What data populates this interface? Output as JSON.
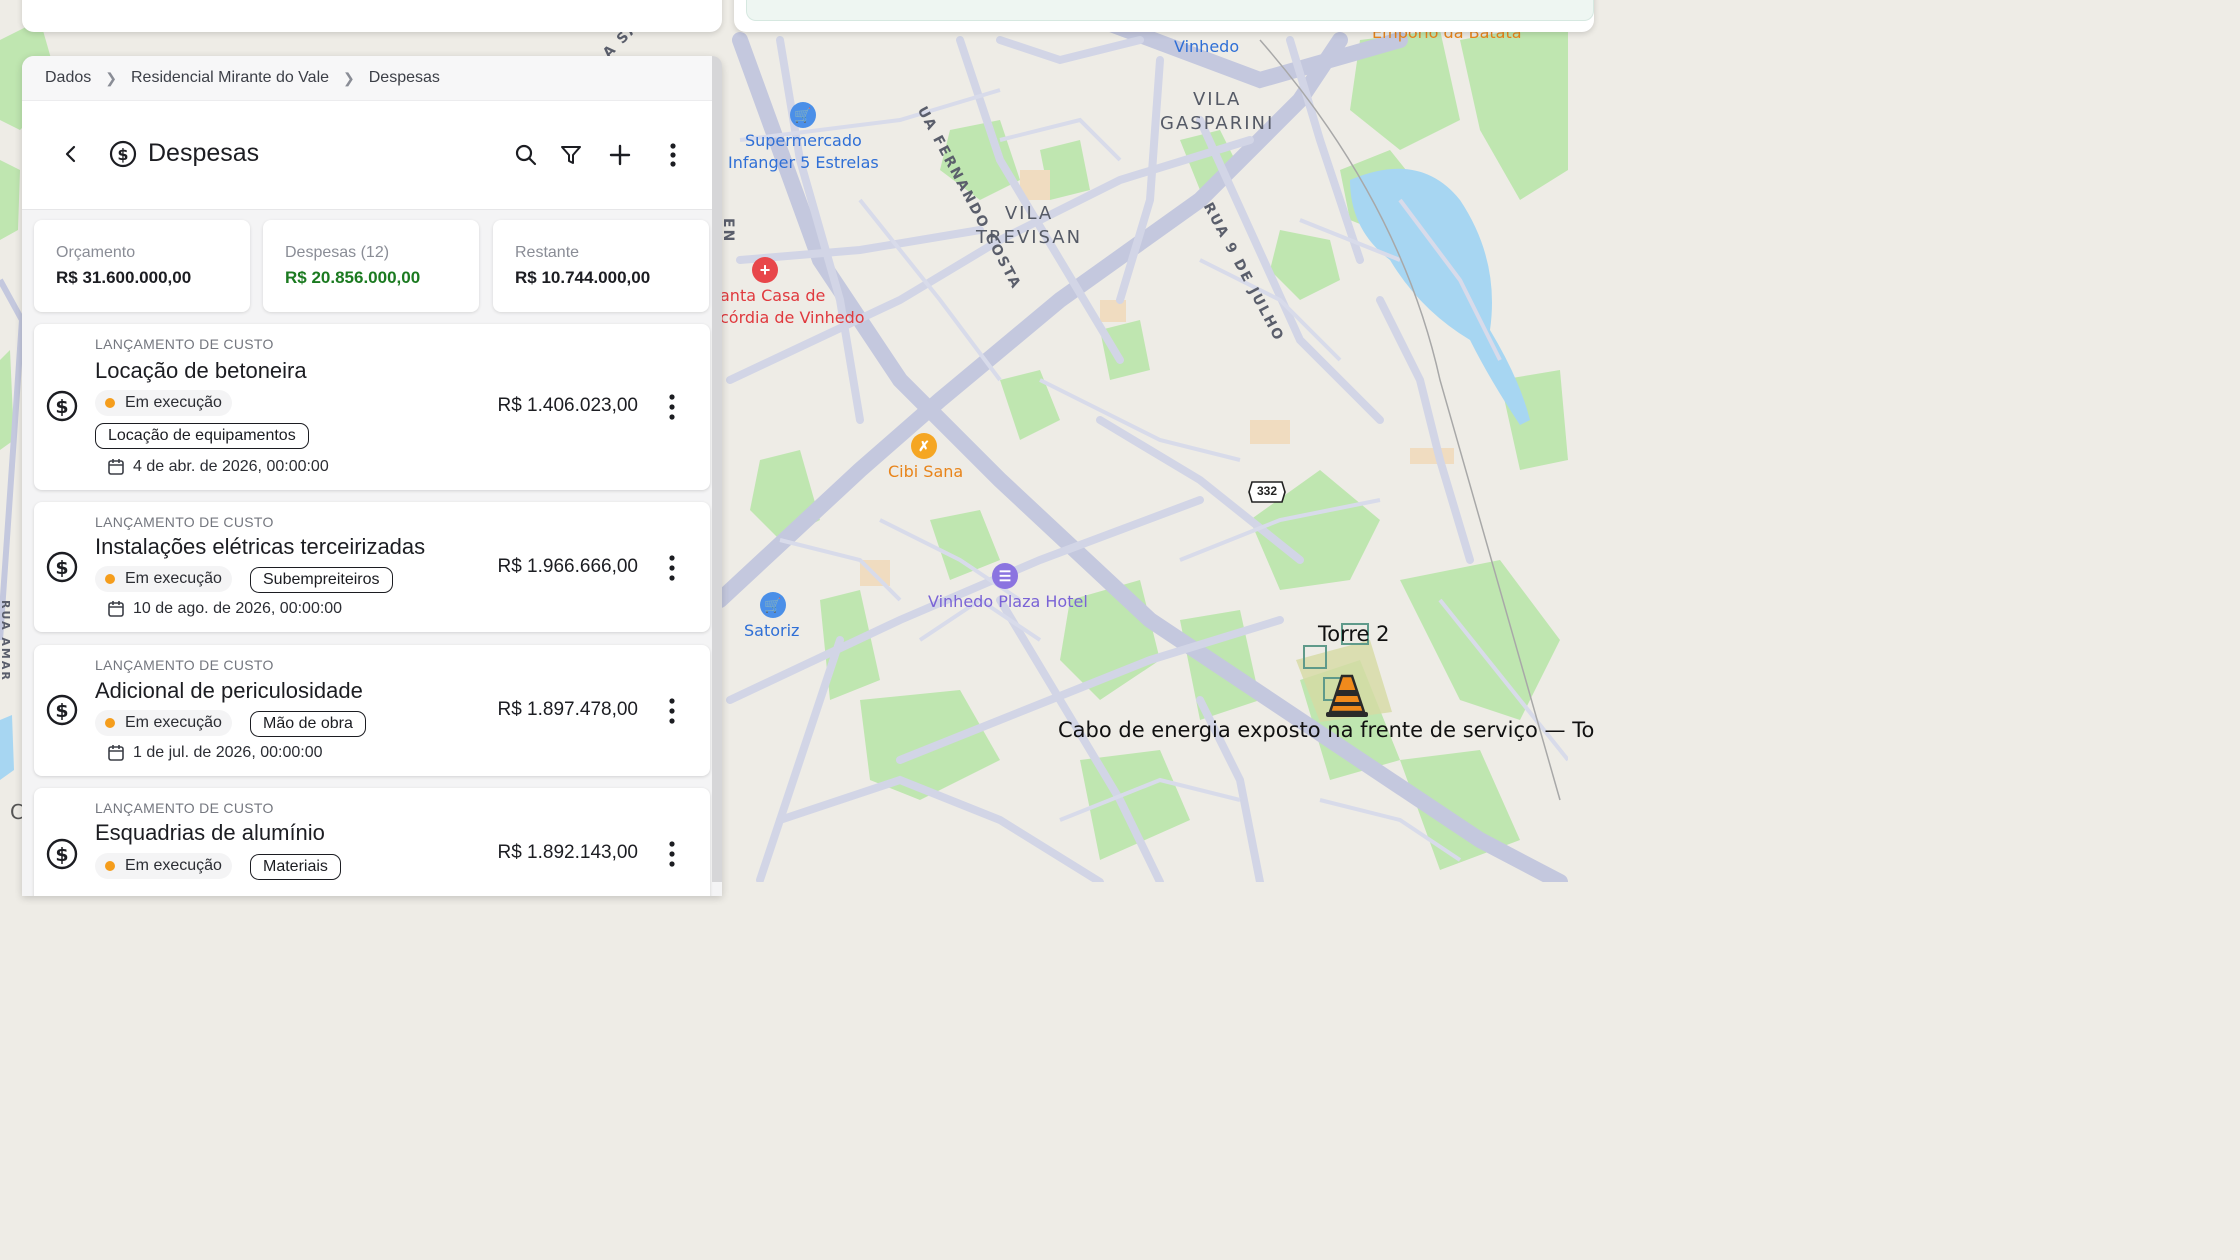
{
  "breadcrumb": [
    "Dados",
    "Residencial Mirante do Vale",
    "Despesas"
  ],
  "header": {
    "title": "Despesas",
    "icons": [
      "back-arrow-icon",
      "dollar-circle-icon",
      "search-icon",
      "filter-icon",
      "plus-icon",
      "more-vert-icon"
    ]
  },
  "summary": {
    "budget": {
      "label": "Orçamento",
      "value": "R$ 31.600.000,00"
    },
    "expenses": {
      "label": "Despesas (12)",
      "value": "R$ 20.856.000,00",
      "color": "#1b7a20"
    },
    "remaining": {
      "label": "Restante",
      "value": "R$ 10.744.000,00"
    }
  },
  "expenses": [
    {
      "type": "LANÇAMENTO DE CUSTO",
      "title": "Locação de betoneira",
      "status": "Em execução",
      "category": "Locação de equipamentos",
      "date": "4 de abr. de 2026, 00:00:00",
      "amount": "R$ 1.406.023,00"
    },
    {
      "type": "LANÇAMENTO DE CUSTO",
      "title": "Instalações elétricas terceirizadas",
      "status": "Em execução",
      "category": "Subempreiteiros",
      "date": "10 de ago. de 2026, 00:00:00",
      "amount": "R$ 1.966.666,00"
    },
    {
      "type": "LANÇAMENTO DE CUSTO",
      "title": "Adicional de periculosidade",
      "status": "Em execução",
      "category": "Mão de obra",
      "date": "1 de jul. de 2026, 00:00:00",
      "amount": "R$ 1.897.478,00"
    },
    {
      "type": "LANÇAMENTO DE CUSTO",
      "title": "Esquadrias de alumínio",
      "status": "Em execução",
      "category": "Materiais",
      "date": "",
      "amount": "R$ 1.892.143,00"
    }
  ],
  "status_color": "#f59d1c",
  "map": {
    "streets": [
      "UA FERNANDO COSTA",
      "RUA 9 DE JULHO",
      "A SA",
      "EN",
      "RUA AMAR"
    ],
    "districts": [
      "VILA\nGASPARINI",
      "VILA\nTREVISAN"
    ],
    "places": [
      {
        "name": "Vinhedo",
        "color": "#2f6fd6"
      },
      {
        "name": "Emporio da Batata",
        "color": "#e8841a"
      },
      {
        "name": "Supermercado\nInfanger 5 Estrelas",
        "color": "#2f6fd6",
        "icon": "cart-icon"
      },
      {
        "name": "anta Casa de\ncórdia de Vinhedo",
        "color": "#e0393e",
        "icon": "hospital-icon"
      },
      {
        "name": "Cibi Sana",
        "color": "#e8841a",
        "icon": "restaurant-icon"
      },
      {
        "name": "Vinhedo Plaza Hotel",
        "color": "#7a63d6",
        "icon": "hotel-icon"
      },
      {
        "name": "Satoriz",
        "color": "#2f6fd6",
        "icon": "cart-icon"
      }
    ],
    "road_shield": "332",
    "site_label": "Torre 2",
    "alert_text": "Cabo de energia exposto na frente de serviço — To",
    "edge_letter": "C",
    "colors": {
      "land": "#eeece6",
      "park": "#b8e2a8",
      "road": "#c9cde0",
      "water": "#a7d6f2"
    }
  }
}
